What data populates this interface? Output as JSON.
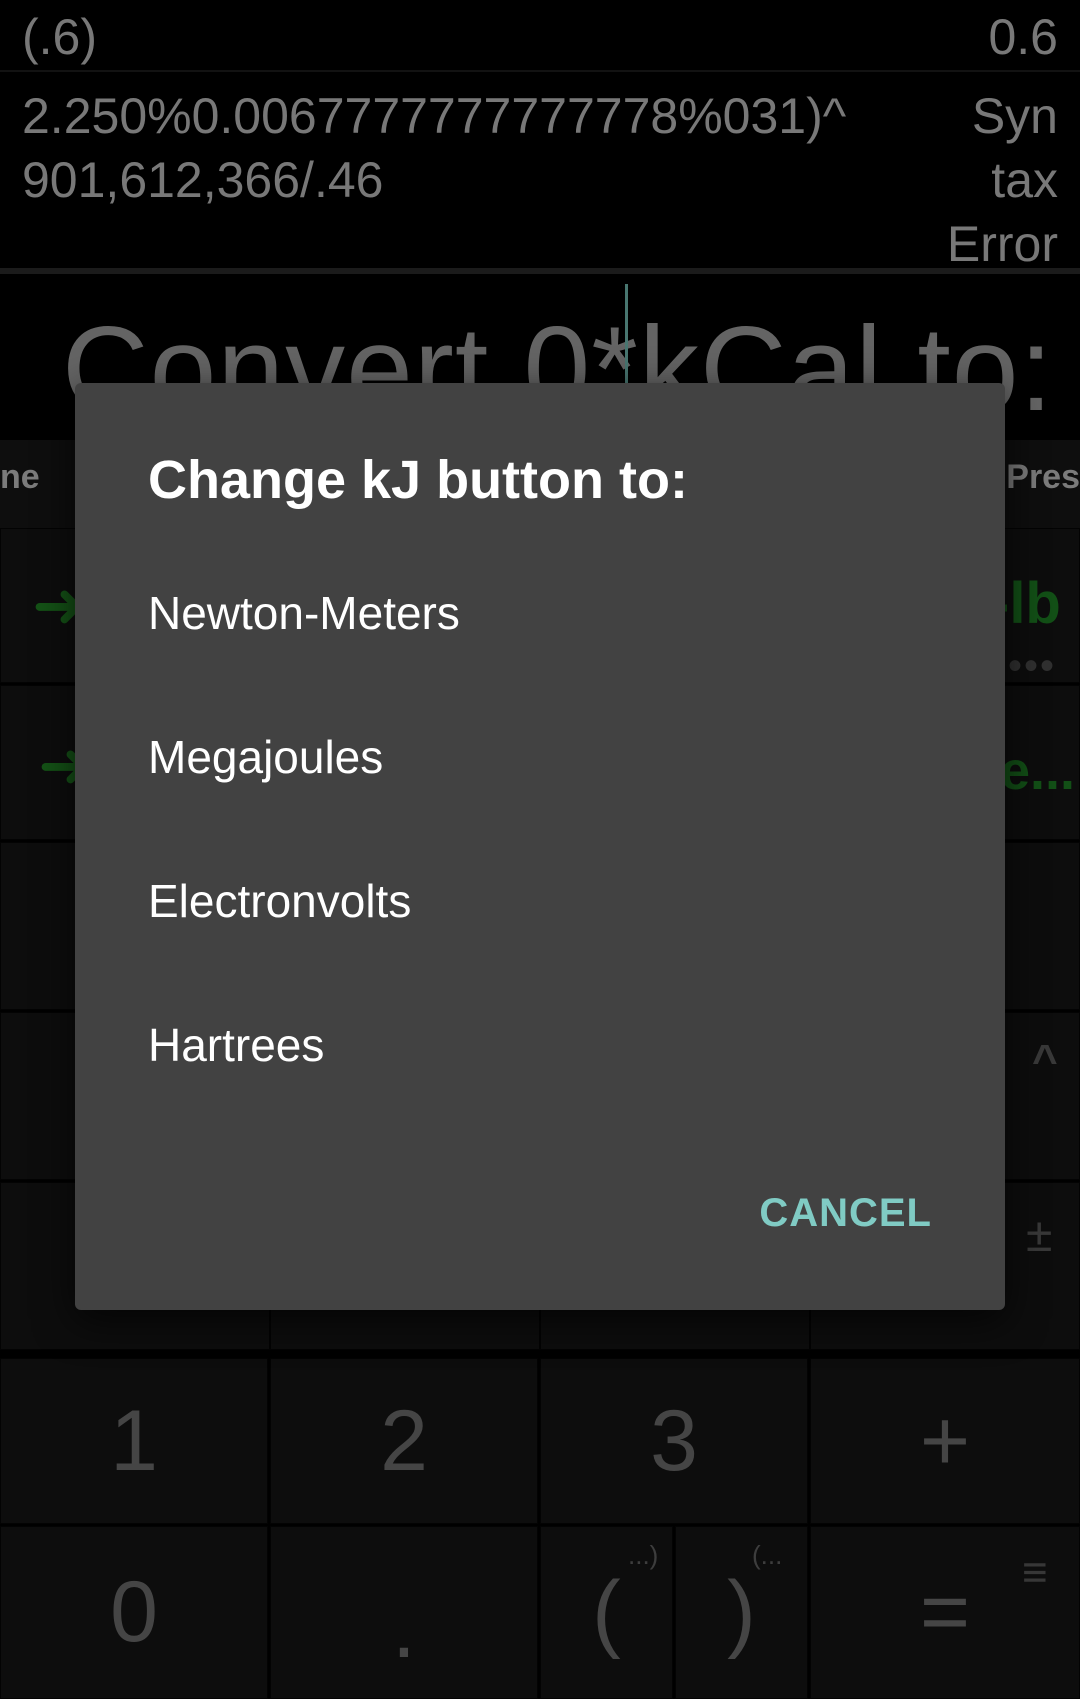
{
  "history": {
    "row1": {
      "expression": "(.6)",
      "result": "0.6"
    },
    "row2": {
      "expression": "2.250%0.0067777777777778%031)^901,612,366/.46",
      "result": "Syn tax Error"
    }
  },
  "input": {
    "text": "Convert 0*kCal to:"
  },
  "unit_strip": {
    "left_label": "ne",
    "right_label": "Pres"
  },
  "keypad": {
    "row1_right": "-lb",
    "row1_right_more": "•••",
    "row2_right": "e...",
    "power_key": "^",
    "plus_minus_key": "±",
    "digits_row": [
      "1",
      "2",
      "3",
      "+"
    ],
    "bottom_row": {
      "zero": "0",
      "dot": ".",
      "open_paren": "(",
      "open_paren_sup": "...)",
      "close_paren": ")",
      "close_paren_sup": "(...",
      "equals": "=",
      "menu_icon": "≡"
    },
    "arrow_glyph": "➜"
  },
  "dialog": {
    "title": "Change kJ button to:",
    "options": [
      "Newton-Meters",
      "Megajoules",
      "Electronvolts",
      "Hartrees"
    ],
    "cancel_label": "CANCEL",
    "accent_color": "#80cbc4"
  }
}
